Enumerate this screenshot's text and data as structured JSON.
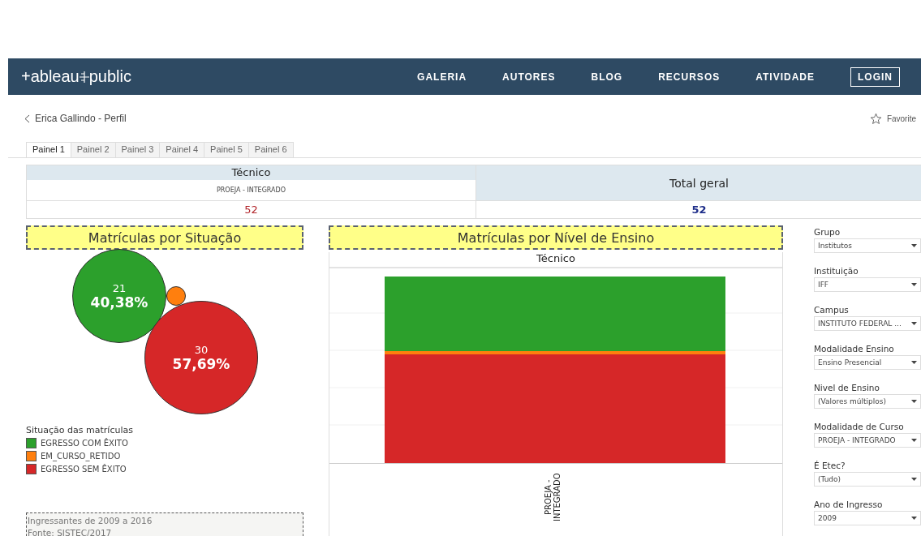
{
  "navbar": {
    "logo": [
      "+ableau",
      "public"
    ],
    "links": [
      "GALERIA",
      "AUTORES",
      "BLOG",
      "RECURSOS",
      "ATIVIDADE"
    ],
    "login": "LOGIN"
  },
  "back_link": "Erica Gallindo - Perfil",
  "favorite": "Favorite",
  "tabs": [
    {
      "label": "Painel 1",
      "selected": true
    },
    {
      "label": "Painel 2",
      "selected": false
    },
    {
      "label": "Painel 3",
      "selected": false
    },
    {
      "label": "Painel 4",
      "selected": false
    },
    {
      "label": "Painel 5",
      "selected": false
    },
    {
      "label": "Painel 6",
      "selected": false
    }
  ],
  "summary_table": {
    "group_header": "Técnico",
    "sub_header": "PROEJA - INTEGRADO",
    "value": "52",
    "total_header": "Total geral",
    "total_value": "52"
  },
  "situation_panel": {
    "title": "Matrículas por Situação",
    "bubbles": [
      {
        "count": "21",
        "percent": "40,38%",
        "color": "#2ca02c"
      },
      {
        "color": "#ff7f0e"
      },
      {
        "count": "30",
        "percent": "57,69%",
        "color": "#d62728"
      }
    ],
    "legend_title": "Situação das matrículas",
    "legend": [
      {
        "label": "EGRESSO COM ÊXITO",
        "color": "#2ca02c"
      },
      {
        "label": "EM_CURSO_RETIDO",
        "color": "#ff7f0e"
      },
      {
        "label": "EGRESSO SEM ÊXITO",
        "color": "#d62728"
      }
    ],
    "note": [
      "Ingressantes de 2009 a 2016",
      "Fonte: SISTEC/2017"
    ]
  },
  "level_panel": {
    "title": "Matrículas por Nível de Ensino",
    "column_header": "Técnico",
    "category": "PROEJA - INTEGRADO"
  },
  "filters": [
    {
      "label": "Grupo",
      "value": "Institutos"
    },
    {
      "label": "Instituição",
      "value": "IFF"
    },
    {
      "label": "Campus",
      "value": "INSTITUTO FEDERAL ..."
    },
    {
      "label": "Modalidade Ensino",
      "value": "Ensino Presencial"
    },
    {
      "label": "Nivel de Ensino",
      "value": "(Valores múltiplos)"
    },
    {
      "label": "Modalidade de Curso",
      "value": "PROEJA - INTEGRADO"
    },
    {
      "label": "É Etec?",
      "value": "(Tudo)"
    },
    {
      "label": "Ano de Ingresso",
      "value": "2009"
    }
  ]
}
